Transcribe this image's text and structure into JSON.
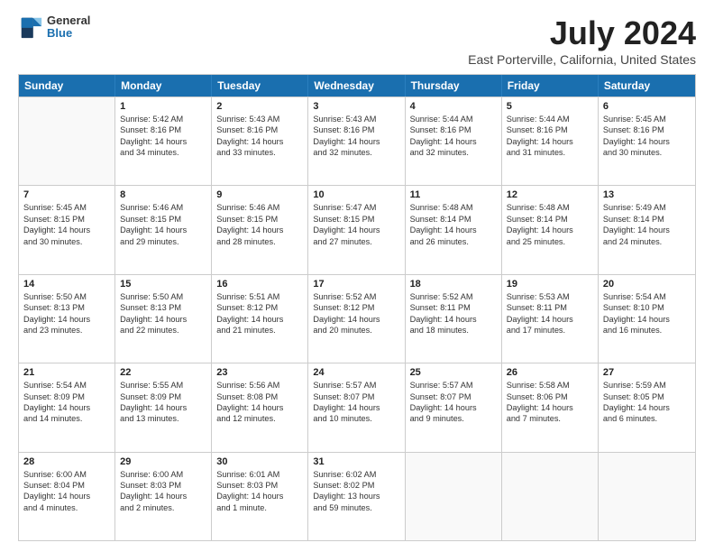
{
  "logo": {
    "line1": "General",
    "line2": "Blue"
  },
  "title": "July 2024",
  "subtitle": "East Porterville, California, United States",
  "weekdays": [
    "Sunday",
    "Monday",
    "Tuesday",
    "Wednesday",
    "Thursday",
    "Friday",
    "Saturday"
  ],
  "rows": [
    [
      {
        "day": "",
        "lines": []
      },
      {
        "day": "1",
        "lines": [
          "Sunrise: 5:42 AM",
          "Sunset: 8:16 PM",
          "Daylight: 14 hours",
          "and 34 minutes."
        ]
      },
      {
        "day": "2",
        "lines": [
          "Sunrise: 5:43 AM",
          "Sunset: 8:16 PM",
          "Daylight: 14 hours",
          "and 33 minutes."
        ]
      },
      {
        "day": "3",
        "lines": [
          "Sunrise: 5:43 AM",
          "Sunset: 8:16 PM",
          "Daylight: 14 hours",
          "and 32 minutes."
        ]
      },
      {
        "day": "4",
        "lines": [
          "Sunrise: 5:44 AM",
          "Sunset: 8:16 PM",
          "Daylight: 14 hours",
          "and 32 minutes."
        ]
      },
      {
        "day": "5",
        "lines": [
          "Sunrise: 5:44 AM",
          "Sunset: 8:16 PM",
          "Daylight: 14 hours",
          "and 31 minutes."
        ]
      },
      {
        "day": "6",
        "lines": [
          "Sunrise: 5:45 AM",
          "Sunset: 8:16 PM",
          "Daylight: 14 hours",
          "and 30 minutes."
        ]
      }
    ],
    [
      {
        "day": "7",
        "lines": [
          "Sunrise: 5:45 AM",
          "Sunset: 8:15 PM",
          "Daylight: 14 hours",
          "and 30 minutes."
        ]
      },
      {
        "day": "8",
        "lines": [
          "Sunrise: 5:46 AM",
          "Sunset: 8:15 PM",
          "Daylight: 14 hours",
          "and 29 minutes."
        ]
      },
      {
        "day": "9",
        "lines": [
          "Sunrise: 5:46 AM",
          "Sunset: 8:15 PM",
          "Daylight: 14 hours",
          "and 28 minutes."
        ]
      },
      {
        "day": "10",
        "lines": [
          "Sunrise: 5:47 AM",
          "Sunset: 8:15 PM",
          "Daylight: 14 hours",
          "and 27 minutes."
        ]
      },
      {
        "day": "11",
        "lines": [
          "Sunrise: 5:48 AM",
          "Sunset: 8:14 PM",
          "Daylight: 14 hours",
          "and 26 minutes."
        ]
      },
      {
        "day": "12",
        "lines": [
          "Sunrise: 5:48 AM",
          "Sunset: 8:14 PM",
          "Daylight: 14 hours",
          "and 25 minutes."
        ]
      },
      {
        "day": "13",
        "lines": [
          "Sunrise: 5:49 AM",
          "Sunset: 8:14 PM",
          "Daylight: 14 hours",
          "and 24 minutes."
        ]
      }
    ],
    [
      {
        "day": "14",
        "lines": [
          "Sunrise: 5:50 AM",
          "Sunset: 8:13 PM",
          "Daylight: 14 hours",
          "and 23 minutes."
        ]
      },
      {
        "day": "15",
        "lines": [
          "Sunrise: 5:50 AM",
          "Sunset: 8:13 PM",
          "Daylight: 14 hours",
          "and 22 minutes."
        ]
      },
      {
        "day": "16",
        "lines": [
          "Sunrise: 5:51 AM",
          "Sunset: 8:12 PM",
          "Daylight: 14 hours",
          "and 21 minutes."
        ]
      },
      {
        "day": "17",
        "lines": [
          "Sunrise: 5:52 AM",
          "Sunset: 8:12 PM",
          "Daylight: 14 hours",
          "and 20 minutes."
        ]
      },
      {
        "day": "18",
        "lines": [
          "Sunrise: 5:52 AM",
          "Sunset: 8:11 PM",
          "Daylight: 14 hours",
          "and 18 minutes."
        ]
      },
      {
        "day": "19",
        "lines": [
          "Sunrise: 5:53 AM",
          "Sunset: 8:11 PM",
          "Daylight: 14 hours",
          "and 17 minutes."
        ]
      },
      {
        "day": "20",
        "lines": [
          "Sunrise: 5:54 AM",
          "Sunset: 8:10 PM",
          "Daylight: 14 hours",
          "and 16 minutes."
        ]
      }
    ],
    [
      {
        "day": "21",
        "lines": [
          "Sunrise: 5:54 AM",
          "Sunset: 8:09 PM",
          "Daylight: 14 hours",
          "and 14 minutes."
        ]
      },
      {
        "day": "22",
        "lines": [
          "Sunrise: 5:55 AM",
          "Sunset: 8:09 PM",
          "Daylight: 14 hours",
          "and 13 minutes."
        ]
      },
      {
        "day": "23",
        "lines": [
          "Sunrise: 5:56 AM",
          "Sunset: 8:08 PM",
          "Daylight: 14 hours",
          "and 12 minutes."
        ]
      },
      {
        "day": "24",
        "lines": [
          "Sunrise: 5:57 AM",
          "Sunset: 8:07 PM",
          "Daylight: 14 hours",
          "and 10 minutes."
        ]
      },
      {
        "day": "25",
        "lines": [
          "Sunrise: 5:57 AM",
          "Sunset: 8:07 PM",
          "Daylight: 14 hours",
          "and 9 minutes."
        ]
      },
      {
        "day": "26",
        "lines": [
          "Sunrise: 5:58 AM",
          "Sunset: 8:06 PM",
          "Daylight: 14 hours",
          "and 7 minutes."
        ]
      },
      {
        "day": "27",
        "lines": [
          "Sunrise: 5:59 AM",
          "Sunset: 8:05 PM",
          "Daylight: 14 hours",
          "and 6 minutes."
        ]
      }
    ],
    [
      {
        "day": "28",
        "lines": [
          "Sunrise: 6:00 AM",
          "Sunset: 8:04 PM",
          "Daylight: 14 hours",
          "and 4 minutes."
        ]
      },
      {
        "day": "29",
        "lines": [
          "Sunrise: 6:00 AM",
          "Sunset: 8:03 PM",
          "Daylight: 14 hours",
          "and 2 minutes."
        ]
      },
      {
        "day": "30",
        "lines": [
          "Sunrise: 6:01 AM",
          "Sunset: 8:03 PM",
          "Daylight: 14 hours",
          "and 1 minute."
        ]
      },
      {
        "day": "31",
        "lines": [
          "Sunrise: 6:02 AM",
          "Sunset: 8:02 PM",
          "Daylight: 13 hours",
          "and 59 minutes."
        ]
      },
      {
        "day": "",
        "lines": []
      },
      {
        "day": "",
        "lines": []
      },
      {
        "day": "",
        "lines": []
      }
    ]
  ]
}
